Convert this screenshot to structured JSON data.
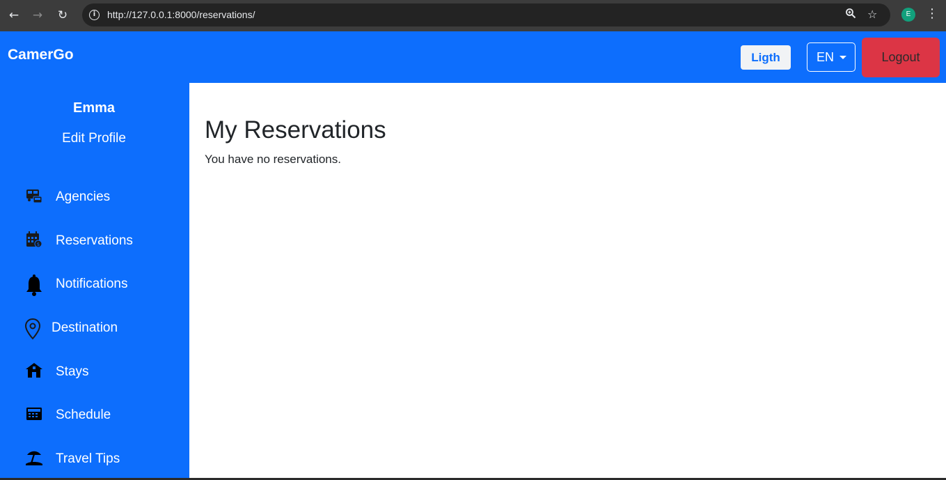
{
  "browser": {
    "back_icon": "←",
    "forward_icon": "→",
    "reload_icon": "↻",
    "url": "http://127.0.0.1:8000/reservations/",
    "profile_initial": "E"
  },
  "navbar": {
    "brand": "CamerGo",
    "theme_label": "Ligth",
    "language_label": "EN",
    "logout_label": "Logout"
  },
  "sidebar": {
    "user_name": "Emma",
    "edit_profile": "Edit Profile",
    "items": [
      {
        "label": "Agencies",
        "icon": "bus-agency-icon"
      },
      {
        "label": "Reservations",
        "icon": "calendar-money-icon"
      },
      {
        "label": "Notifications",
        "icon": "bell-icon"
      },
      {
        "label": "Destination",
        "icon": "map-pin-icon"
      },
      {
        "label": "Stays",
        "icon": "house-icon"
      },
      {
        "label": "Schedule",
        "icon": "calculator-icon"
      },
      {
        "label": "Travel Tips",
        "icon": "beach-icon"
      }
    ]
  },
  "main": {
    "title": "My Reservations",
    "empty_message": "You have no reservations."
  },
  "colors": {
    "primary": "#0d6efd",
    "danger": "#dc3545",
    "light": "#f1f3f5",
    "text": "#212529"
  }
}
